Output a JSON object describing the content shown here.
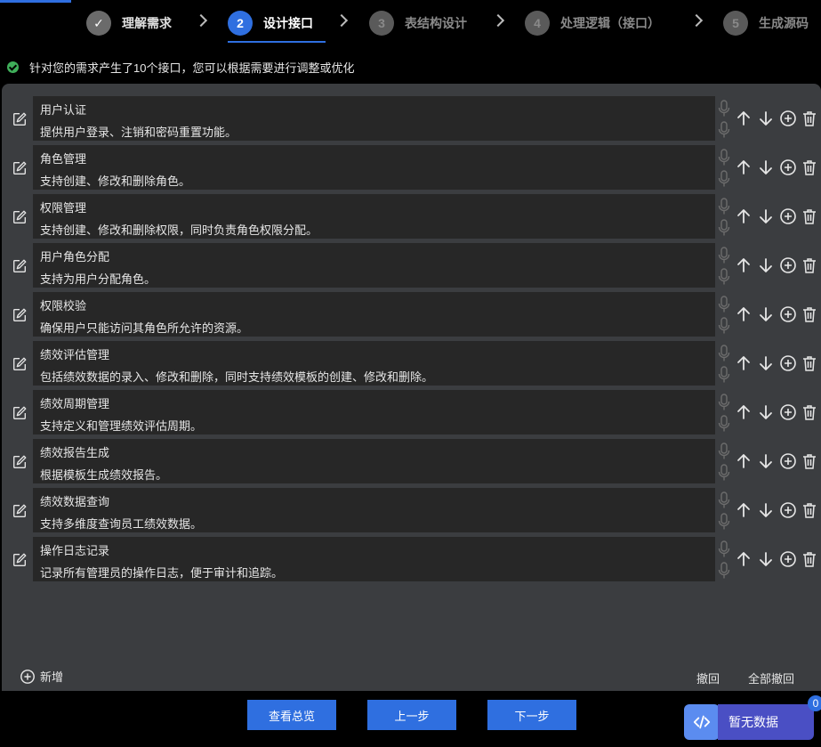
{
  "steps": [
    {
      "num": "✓",
      "label": "理解需求",
      "state": "done"
    },
    {
      "num": "2",
      "label": "设计接口",
      "state": "active"
    },
    {
      "num": "3",
      "label": "表结构设计",
      "state": "todo"
    },
    {
      "num": "4",
      "label": "处理逻辑（接口）",
      "state": "todo"
    },
    {
      "num": "5",
      "label": "生成源码",
      "state": "todo"
    }
  ],
  "notice": {
    "text": "针对您的需求产生了10个接口，您可以根据需要进行调整或优化"
  },
  "interfaces": [
    {
      "title": "用户认证",
      "desc": "提供用户登录、注销和密码重置功能。"
    },
    {
      "title": "角色管理",
      "desc": "支持创建、修改和删除角色。"
    },
    {
      "title": "权限管理",
      "desc": "支持创建、修改和删除权限，同时负责角色权限分配。"
    },
    {
      "title": "用户角色分配",
      "desc": "支持为用户分配角色。"
    },
    {
      "title": "权限校验",
      "desc": "确保用户只能访问其角色所允许的资源。"
    },
    {
      "title": "绩效评估管理",
      "desc": "包括绩效数据的录入、修改和删除，同时支持绩效模板的创建、修改和删除。"
    },
    {
      "title": "绩效周期管理",
      "desc": "支持定义和管理绩效评估周期。"
    },
    {
      "title": "绩效报告生成",
      "desc": "根据模板生成绩效报告。"
    },
    {
      "title": "绩效数据查询",
      "desc": "支持多维度查询员工绩效数据。"
    },
    {
      "title": "操作日志记录",
      "desc": "记录所有管理员的操作日志，便于审计和追踪。"
    }
  ],
  "panel_footer": {
    "add_label": "新增",
    "undo_label": "撤回",
    "undo_all_label": "全部撤回"
  },
  "buttons": {
    "overview": "查看总览",
    "prev": "上一步",
    "next": "下一步"
  },
  "float_badge": {
    "label": "暂无数据",
    "count": "0"
  },
  "colors": {
    "accent": "#2f6fe0",
    "panel": "#3b3d40",
    "row": "#272727",
    "success": "#3fae5a",
    "badge": "#4a4fc4"
  }
}
